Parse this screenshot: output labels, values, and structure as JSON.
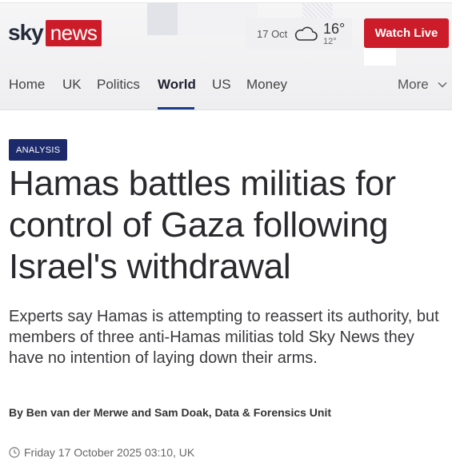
{
  "brand": {
    "logo_sky": "sky",
    "logo_news": "news",
    "accent_color": "#cc1c2a"
  },
  "weather": {
    "date": "17 Oct",
    "icon": "cloud-icon",
    "high": "16°",
    "low": "12°"
  },
  "header": {
    "watch_live_label": "Watch Live"
  },
  "nav": {
    "items": [
      {
        "label": "Home",
        "active": false
      },
      {
        "label": "UK",
        "active": false
      },
      {
        "label": "Politics",
        "active": false
      },
      {
        "label": "World",
        "active": true
      },
      {
        "label": "US",
        "active": false
      },
      {
        "label": "Money",
        "active": false
      }
    ],
    "more_label": "More"
  },
  "article": {
    "label": "ANALYSIS",
    "headline": "Hamas battles militias for control of Gaza following Israel's withdrawal",
    "standfirst": "Experts say Hamas is attempting to reassert its authority, but members of three anti-Hamas militias told Sky News they have no intention of laying down their arms.",
    "byline": "By Ben van der Merwe and Sam Doak, Data & Forensics Unit",
    "timestamp": "Friday 17 October 2025 03:10, UK"
  }
}
